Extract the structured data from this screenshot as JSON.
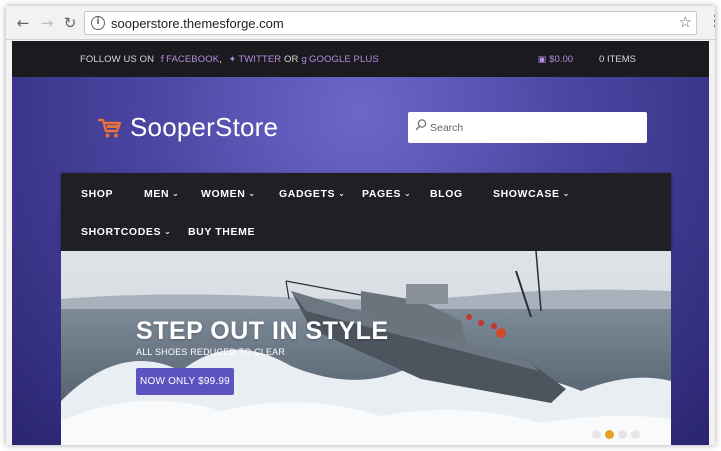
{
  "browser": {
    "url": "sooperstore.themesforge.com",
    "back_icon": "arrow-left-icon",
    "forward_icon": "arrow-right-icon",
    "reload_icon": "reload-icon",
    "bookmark_icon": "star-icon"
  },
  "topbar": {
    "follow_prefix": "FOLLOW US ON",
    "facebook": "FACEBOOK",
    "sep1": ",",
    "twitter": "TWITTER",
    "or": "OR",
    "google": "GOOGLE PLUS",
    "cart_total": "$0.00",
    "cart_items": "0 ITEMS"
  },
  "header": {
    "logo": "SooperStore",
    "search_placeholder": "Search"
  },
  "nav": {
    "shop": "SHOP",
    "men": "MEN",
    "women": "WOMEN",
    "gadgets": "GADGETS",
    "pages": "PAGES",
    "blog": "BLOG",
    "showcase": "SHOWCASE",
    "shortcodes": "SHORTCODES",
    "buy_theme": "BUY THEME"
  },
  "slider": {
    "title": "STEP OUT IN STYLE",
    "subtitle": "ALL SHOES REDUCED TO CLEAR",
    "button": "NOW ONLY $99.99",
    "slide_count": 4,
    "active_slide": 2
  },
  "colors": {
    "accent": "#b58ae0",
    "button": "#5a53c0",
    "active_dot": "#e5a21d",
    "nav_bg": "#1f1f24"
  }
}
